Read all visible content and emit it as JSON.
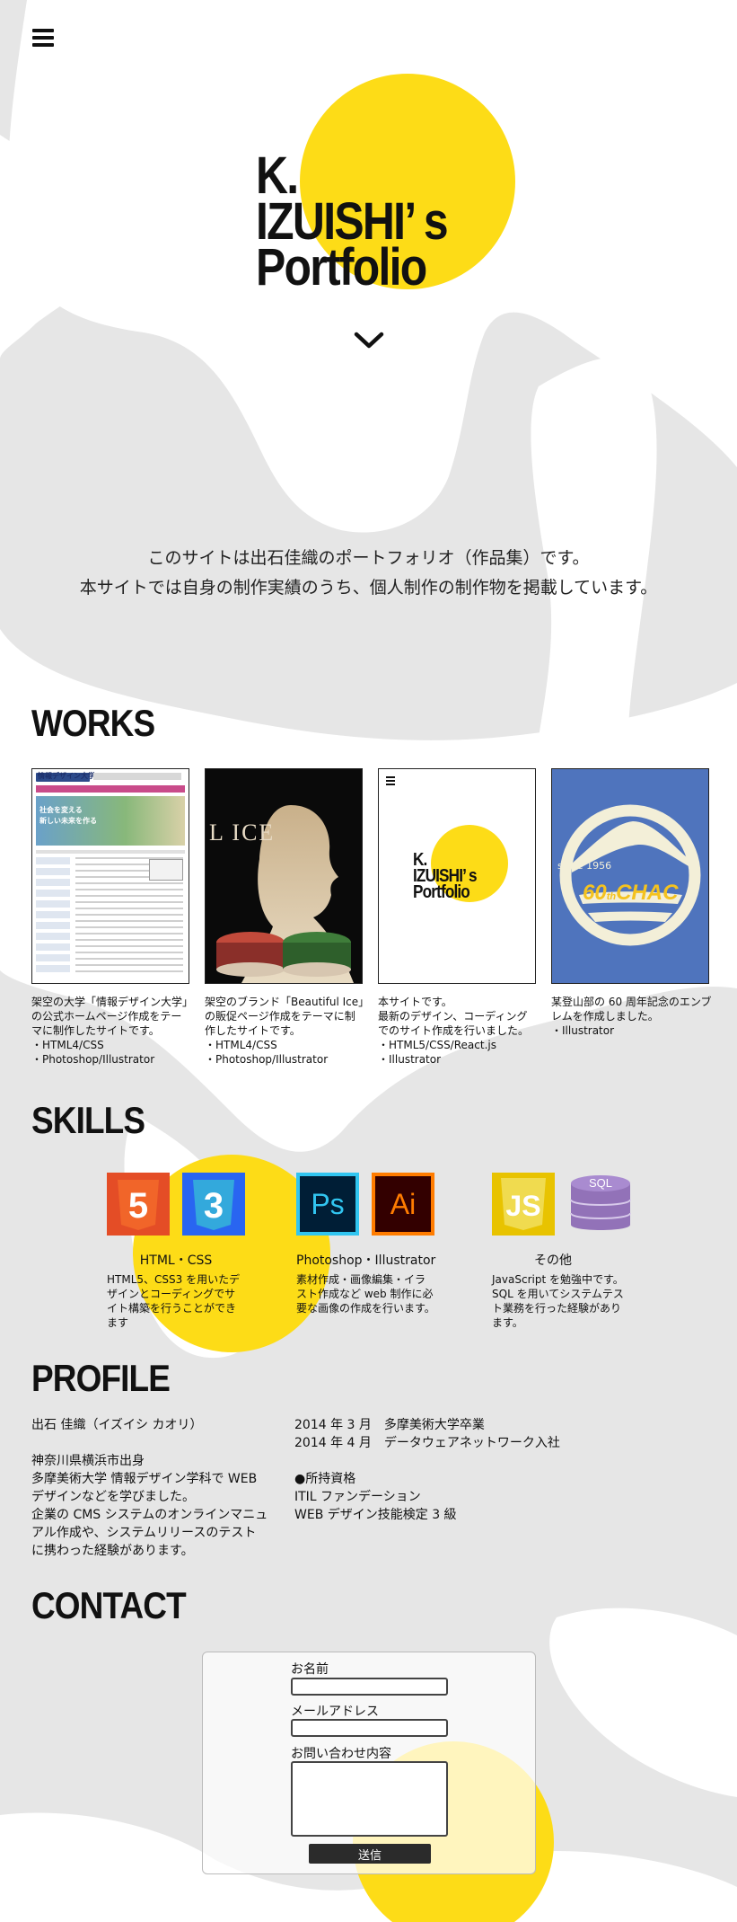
{
  "hero": {
    "title_line1": "K.",
    "title_line2": "IZUISHI’ s",
    "title_line3": "Portfolio"
  },
  "intro": {
    "line1": "このサイトは出石佳織のポートフォリオ（作品集）です。",
    "line2": "本サイトでは自身の制作実績のうち、個人制作の制作物を掲載しています。"
  },
  "works": {
    "heading": "WORKS",
    "items": [
      {
        "lines": [
          "架空の大学「情報デザイン大学」",
          "の公式ホームページ作成をテー",
          "マに制作したサイトです。",
          "・HTML4/CSS",
          "・Photoshop/Illustrator"
        ],
        "thumb_title": "情報デザイン大学",
        "thumb_banner_line1": "社会を変える",
        "thumb_banner_line2": "新しい未来を作る"
      },
      {
        "lines": [
          "架空のブランド「Beautiful Ice」",
          "の販促ページ作成をテーマに制",
          "作したサイトです。",
          "・HTML4/CSS",
          "・Photoshop/Illustrator"
        ],
        "thumb_text": "L ICE"
      },
      {
        "lines": [
          "本サイトです。",
          "最新のデザイン、コーディング",
          "でのサイト作成を行いました。",
          "・HTML5/CSS/React.js",
          "・Illustrator"
        ],
        "thumb_line1": "K.",
        "thumb_line2": "IZUISHI’ s",
        "thumb_line3": "Portfolio"
      },
      {
        "lines": [
          "某登山部の 60 周年記念のエンブ",
          "レムを作成しました。",
          "・Illustrator"
        ],
        "thumb_since": "since 1956",
        "thumb_num": "60",
        "thumb_th": "th",
        "thumb_name": "CHAC"
      }
    ]
  },
  "skills": {
    "heading": "SKILLS",
    "groups": [
      {
        "title": "HTML・CSS",
        "desc": [
          "HTML5、CSS3 を用いたデ",
          "ザインとコーディングでサ",
          "イト構築を行うことができ",
          "ます"
        ],
        "icons": [
          {
            "label": "5",
            "color": "#e44d26"
          },
          {
            "label": "3",
            "color": "#2965f1"
          }
        ]
      },
      {
        "title": "Photoshop・Illustrator",
        "desc": [
          "素材作成・画像編集・イラ",
          "スト作成など web 制作に必",
          "要な画像の作成を行います。"
        ],
        "icons": [
          {
            "label": "Ps",
            "color": "#001e36"
          },
          {
            "label": "Ai",
            "color": "#330000"
          }
        ]
      },
      {
        "title": "その他",
        "desc": [
          "JavaScript を勉強中です。",
          "SQL を用いてシステムテス",
          "ト業務を行った経験があり",
          "ます。"
        ],
        "icons": [
          {
            "label": "JS",
            "color": "#f0db4f"
          },
          {
            "label": "SQL",
            "color": "#9272b8"
          }
        ]
      }
    ]
  },
  "profile": {
    "heading": "PROFILE",
    "left": [
      "出石 佳織（イズイシ カオリ）",
      "",
      "神奈川県横浜市出身",
      "多摩美術大学 情報デザイン学科で WEB",
      "デザインなどを学びました。",
      "企業の CMS システムのオンラインマニュ",
      "アル作成や、システムリリースのテスト",
      "に携わった経験があります。"
    ],
    "right": [
      "2014 年 3 月　多摩美術大学卒業",
      "2014 年 4 月　データウェアネットワーク入社",
      "",
      "●所持資格",
      "ITIL ファンデーション",
      "WEB デザイン技能検定 3 級"
    ]
  },
  "contact": {
    "heading": "CONTACT",
    "name_label": "お名前",
    "email_label": "メールアドレス",
    "message_label": "お問い合わせ内容",
    "submit_label": "送信",
    "name_value": "",
    "email_value": "",
    "message_value": ""
  },
  "colors": {
    "accent": "#fddc17",
    "background": "#e6e6e6",
    "shape": "#ffffff",
    "text": "#111111"
  }
}
